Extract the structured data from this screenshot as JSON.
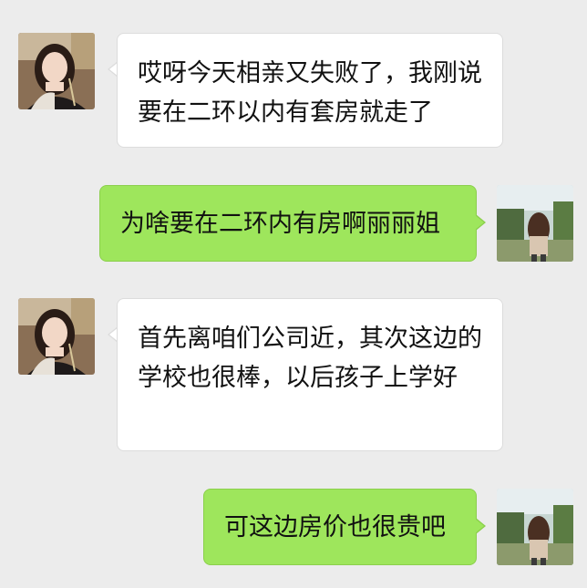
{
  "messages": [
    {
      "side": "left",
      "sender_avatar": "woman-portrait-avatar",
      "text": "哎呀今天相亲又失败了，我刚说要在二环以内有套房就走了"
    },
    {
      "side": "right",
      "sender_avatar": "girl-garden-avatar",
      "text": "为啥要在二环内有房啊丽丽姐"
    },
    {
      "side": "left",
      "sender_avatar": "woman-portrait-avatar",
      "text": "首先离咱们公司近，其次这边的学校也很棒，以后孩子上学好"
    },
    {
      "side": "right",
      "sender_avatar": "girl-garden-avatar",
      "text": "可这边房价也很贵吧"
    }
  ],
  "colors": {
    "background": "#ececec",
    "left_bubble": "#ffffff",
    "right_bubble": "#9ee65c",
    "text": "#111111"
  }
}
